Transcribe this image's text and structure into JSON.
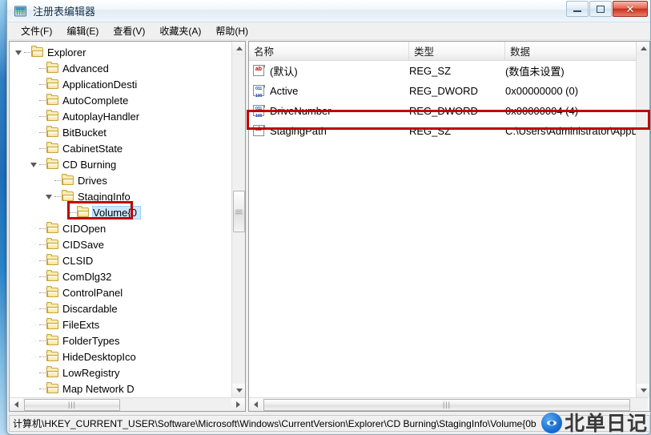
{
  "window": {
    "title": "注册表编辑器",
    "icon": "regedit-icon",
    "buttons": {
      "minimize": "–",
      "maximize": "□",
      "close": "✕"
    }
  },
  "menubar": {
    "items": [
      {
        "label": "文件(F)",
        "name": "menu-file"
      },
      {
        "label": "编辑(E)",
        "name": "menu-edit"
      },
      {
        "label": "查看(V)",
        "name": "menu-view"
      },
      {
        "label": "收藏夹(A)",
        "name": "menu-favorites"
      },
      {
        "label": "帮助(H)",
        "name": "menu-help"
      }
    ]
  },
  "tree": {
    "nodes": [
      {
        "label": "Explorer",
        "depth": 0,
        "state": "expanded",
        "selected": false
      },
      {
        "label": "Advanced",
        "depth": 1,
        "state": "leaf",
        "selected": false
      },
      {
        "label": "ApplicationDesti",
        "depth": 1,
        "state": "leaf",
        "selected": false
      },
      {
        "label": "AutoComplete",
        "depth": 1,
        "state": "leaf",
        "selected": false
      },
      {
        "label": "AutoplayHandler",
        "depth": 1,
        "state": "collapsed",
        "selected": false
      },
      {
        "label": "BitBucket",
        "depth": 1,
        "state": "collapsed",
        "selected": false
      },
      {
        "label": "CabinetState",
        "depth": 1,
        "state": "leaf",
        "selected": false
      },
      {
        "label": "CD Burning",
        "depth": 1,
        "state": "expanded",
        "selected": false
      },
      {
        "label": "Drives",
        "depth": 2,
        "state": "leaf",
        "selected": false
      },
      {
        "label": "StagingInfo",
        "depth": 2,
        "state": "expanded",
        "selected": false
      },
      {
        "label": "Volume{0",
        "depth": 3,
        "state": "leaf",
        "selected": true
      },
      {
        "label": "CIDOpen",
        "depth": 1,
        "state": "collapsed",
        "selected": false
      },
      {
        "label": "CIDSave",
        "depth": 1,
        "state": "collapsed",
        "selected": false
      },
      {
        "label": "CLSID",
        "depth": 1,
        "state": "collapsed",
        "selected": false
      },
      {
        "label": "ComDlg32",
        "depth": 1,
        "state": "collapsed",
        "selected": false
      },
      {
        "label": "ControlPanel",
        "depth": 1,
        "state": "leaf",
        "selected": false
      },
      {
        "label": "Discardable",
        "depth": 1,
        "state": "collapsed",
        "selected": false
      },
      {
        "label": "FileExts",
        "depth": 1,
        "state": "collapsed",
        "selected": false
      },
      {
        "label": "FolderTypes",
        "depth": 1,
        "state": "collapsed",
        "selected": false
      },
      {
        "label": "HideDesktopIco",
        "depth": 1,
        "state": "collapsed",
        "selected": false
      },
      {
        "label": "LowRegistry",
        "depth": 1,
        "state": "leaf",
        "selected": false
      },
      {
        "label": "Map Network D",
        "depth": 1,
        "state": "leaf",
        "selected": false
      }
    ]
  },
  "list": {
    "columns": [
      {
        "label": "名称",
        "name": "column-name"
      },
      {
        "label": "类型",
        "name": "column-type"
      },
      {
        "label": "数据",
        "name": "column-data"
      }
    ],
    "rows": [
      {
        "icon": "string-value-icon",
        "icon_text": "ab",
        "name": "(默认)",
        "type": "REG_SZ",
        "data": "(数值未设置)",
        "highlighted": false
      },
      {
        "icon": "dword-value-icon",
        "icon_text": "011",
        "name": "Active",
        "type": "REG_DWORD",
        "data": "0x00000000 (0)",
        "highlighted": false
      },
      {
        "icon": "dword-value-icon",
        "icon_text": "011",
        "name": "DriveNumber",
        "type": "REG_DWORD",
        "data": "0x00000004 (4)",
        "highlighted": false
      },
      {
        "icon": "string-value-icon",
        "icon_text": "ab",
        "name": "StagingPath",
        "type": "REG_SZ",
        "data": "C:\\Users\\Administrator\\AppD",
        "highlighted": true
      }
    ]
  },
  "statusbar": {
    "path": "计算机\\HKEY_CURRENT_USER\\Software\\Microsoft\\Windows\\CurrentVersion\\Explorer\\CD Burning\\StagingInfo\\Volume{0b"
  },
  "watermark": {
    "text": "北单日记",
    "logo_glyph": "●"
  },
  "colors": {
    "highlight_box": "#c00000",
    "selection": "#cce8ff",
    "title_text": "#0b2c4c",
    "folder": "#f3d98a"
  }
}
